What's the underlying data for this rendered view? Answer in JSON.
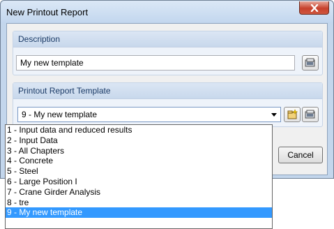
{
  "window": {
    "title": "New Printout Report"
  },
  "description_group": {
    "label": "Description",
    "value": "My new template"
  },
  "template_group": {
    "label": "Printout Report Template",
    "selected": "9 - My new template"
  },
  "buttons": {
    "cancel": "Cancel"
  },
  "dropdown": {
    "items": [
      "1 - Input data and reduced results",
      "2 - Input Data",
      "3 - All Chapters",
      "4 - Concrete",
      "5 - Steel",
      "6 - Large Position I",
      "7 - Crane Girder Analysis",
      "8 - tre",
      "9 - My new template"
    ],
    "selected_index": 8
  },
  "icons": {
    "close": "close-icon",
    "browse": "browse-icon",
    "new_template": "new-template-icon",
    "edit_template": "edit-template-icon"
  }
}
